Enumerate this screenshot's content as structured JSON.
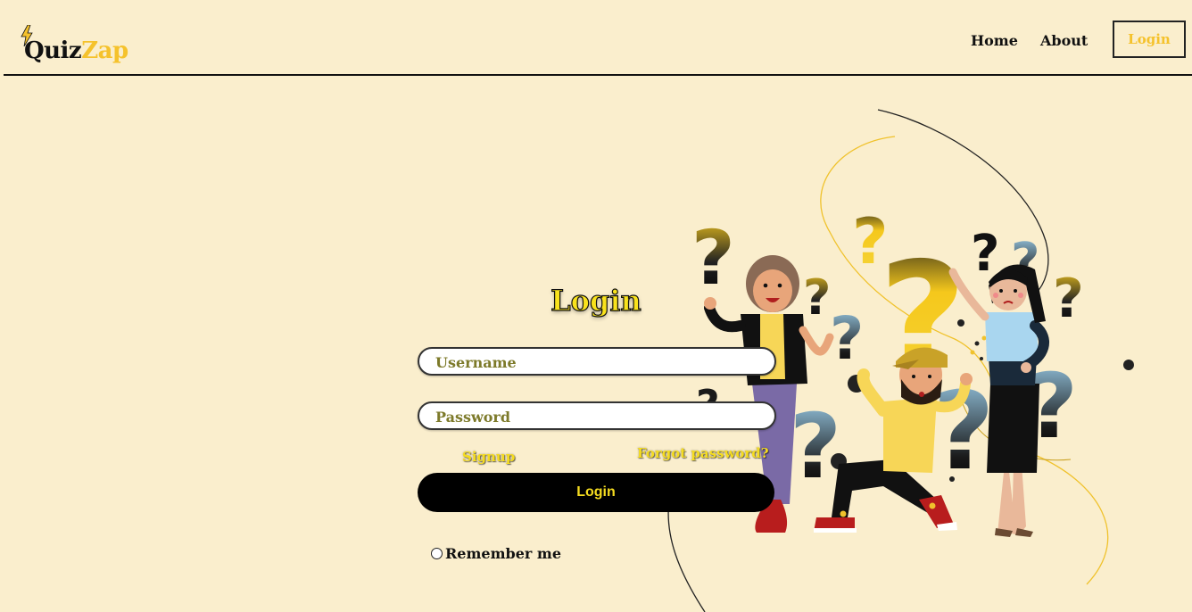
{
  "brand": {
    "logo_part1": "Quiz",
    "logo_part2": "Zap"
  },
  "nav": {
    "home": "Home",
    "about": "About",
    "login": "Login"
  },
  "login_form": {
    "title": "Login",
    "username_placeholder": "Username",
    "password_placeholder": "Password",
    "signup_link": "Signup",
    "forgot_link": "Forgot password?",
    "submit_label": "Login",
    "remember_label": "Remember me"
  },
  "colors": {
    "background": "#faeecd",
    "accent": "#f5c22c",
    "button": "#000000"
  }
}
